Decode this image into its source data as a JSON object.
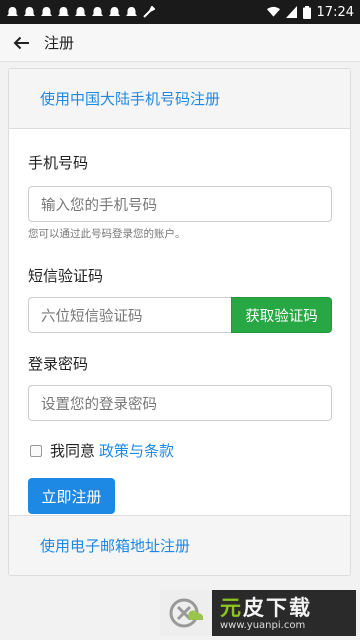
{
  "status_bar": {
    "time": "17:24"
  },
  "app_bar": {
    "title": "注册"
  },
  "card": {
    "header_link": "使用中国大陆手机号码注册",
    "phone": {
      "label": "手机号码",
      "placeholder": "输入您的手机号码",
      "help": "您可以通过此号码登录您的账户。"
    },
    "sms": {
      "label": "短信验证码",
      "placeholder": "六位短信验证码",
      "button": "获取验证码"
    },
    "password": {
      "label": "登录密码",
      "placeholder": "设置您的登录密码"
    },
    "agree": {
      "text": "我同意",
      "link": "政策与条款",
      "checked": false
    },
    "submit": "立即注册",
    "footer_link": "使用电子邮箱地址注册"
  },
  "watermark": {
    "brand_part1": "元",
    "brand_part2": "皮下载",
    "url": "www.yuanpi.com"
  },
  "colors": {
    "primary": "#1e88e5",
    "success": "#28a745",
    "status_bar": "#1a1a1a"
  }
}
